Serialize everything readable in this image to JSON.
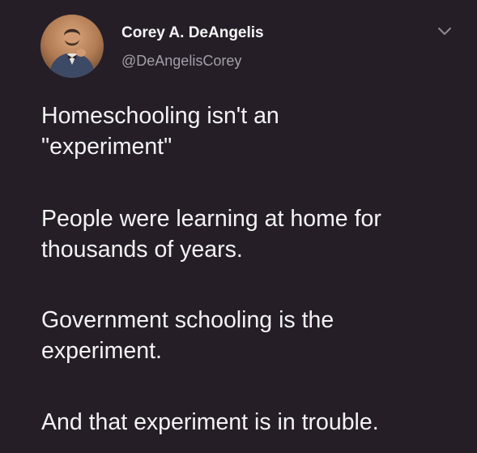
{
  "author": {
    "display_name": "Corey A. DeAngelis",
    "handle": "@DeAngelisCorey",
    "avatar_icon": "profile-photo"
  },
  "menu": {
    "icon": "chevron-down-icon"
  },
  "body": {
    "paragraphs": [
      {
        "lines": [
          "Homeschooling isn't an",
          "\"experiment\""
        ]
      },
      {
        "lines": [
          "People were learning at home for",
          "thousands of years."
        ]
      },
      {
        "lines": [
          "Government schooling is the",
          "experiment."
        ]
      },
      {
        "lines": [
          "And that experiment is in trouble."
        ]
      }
    ]
  },
  "colors": {
    "background": "#251e27",
    "text": "#f4f2f5",
    "secondary_text": "#a39fa8"
  }
}
